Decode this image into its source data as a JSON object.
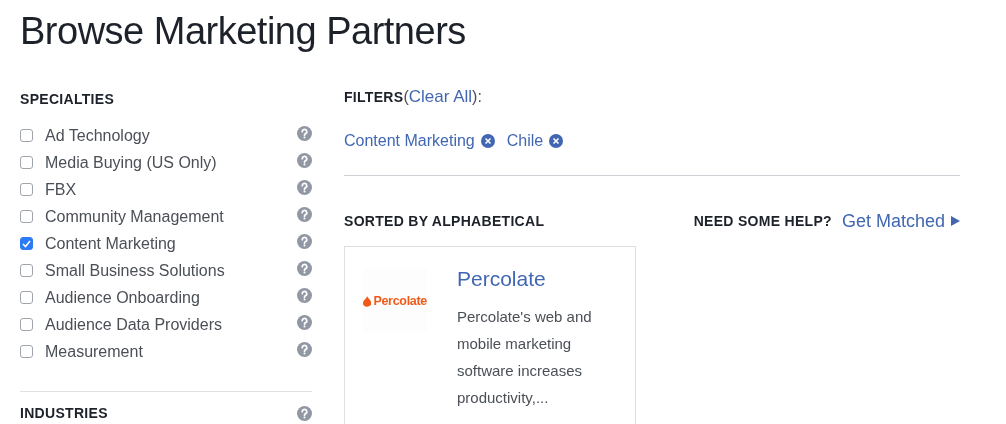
{
  "page_title": "Browse Marketing Partners",
  "sidebar": {
    "sections": [
      {
        "heading": "SPECIALTIES",
        "items": [
          {
            "label": "Ad Technology",
            "checked": false
          },
          {
            "label": "Media Buying (US Only)",
            "checked": false
          },
          {
            "label": "FBX",
            "checked": false
          },
          {
            "label": "Community Management",
            "checked": false
          },
          {
            "label": "Content Marketing",
            "checked": true
          },
          {
            "label": "Small Business Solutions",
            "checked": false
          },
          {
            "label": "Audience Onboarding",
            "checked": false
          },
          {
            "label": "Audience Data Providers",
            "checked": false
          },
          {
            "label": "Measurement",
            "checked": false
          }
        ]
      },
      {
        "heading": "INDUSTRIES"
      }
    ]
  },
  "filters": {
    "heading": "FILTERS",
    "open_paren": "(",
    "clear_link": "Clear All",
    "close_paren": "):",
    "chips": [
      {
        "label": "Content Marketing"
      },
      {
        "label": "Chile"
      }
    ]
  },
  "sort_label": "SORTED BY ALPHABETICAL",
  "help": {
    "label": "NEED SOME HELP?",
    "link": "Get Matched"
  },
  "partners": [
    {
      "logo_text": "Percolate",
      "name": "Percolate",
      "description": "Percolate's web and mobile marketing software increases productivity,..."
    }
  ]
}
